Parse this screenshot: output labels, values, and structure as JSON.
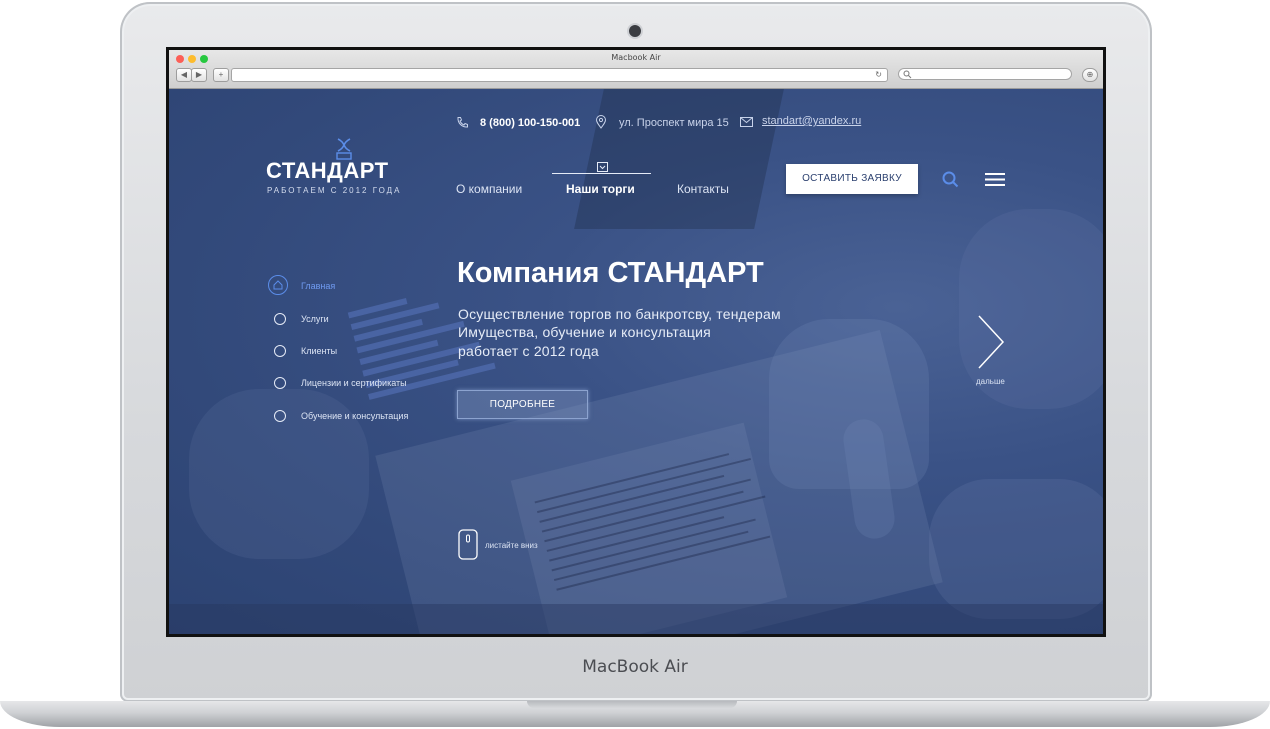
{
  "window": {
    "title": "Macbook Air"
  },
  "device": {
    "brand": "MacBook Air"
  },
  "browser": {
    "back": "◀",
    "forward": "▶",
    "new_tab": "+",
    "reload": "↻",
    "search_icon": "magnifier-icon"
  },
  "header": {
    "phone": "8 (800) 100-150-001",
    "address": "ул. Проспект мира 15",
    "email": "standart@yandex.ru"
  },
  "logo": {
    "name": "СТАНДАРТ",
    "tagline": "РАБОТАЕМ С 2012 ГОДА"
  },
  "nav": {
    "items": [
      {
        "label": "О компании"
      },
      {
        "label": "Наши торги"
      },
      {
        "label": "Контакты"
      }
    ],
    "active": "Наши торги"
  },
  "cta": {
    "label": "ОСТАВИТЬ ЗАЯВКУ"
  },
  "side_nav": {
    "items": [
      {
        "label": "Главная"
      },
      {
        "label": "Услуги"
      },
      {
        "label": "Клиенты"
      },
      {
        "label": "Лицензии и сертификаты"
      },
      {
        "label": "Обучение и консультация"
      }
    ],
    "active_color": "#5b8de9"
  },
  "hero": {
    "title": "Компания СТАНДАРТ",
    "line1": "Осуществление торгов по банкротсву, тендерам",
    "line2": "Имущества, обучение и консультация",
    "line3": "работает с 2012 года",
    "more_button": "ПОДРОБНЕЕ"
  },
  "next": {
    "label": "дальше"
  },
  "scroll": {
    "label": "листайте вниз"
  },
  "colors": {
    "overlay": "#34497a",
    "accent": "#5b8de9",
    "button_bg": "#ffffff",
    "button_text": "#2a3f6e"
  }
}
